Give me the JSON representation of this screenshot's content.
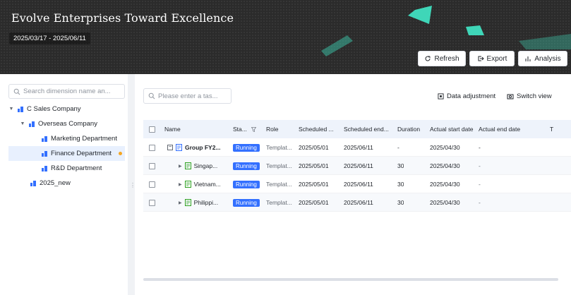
{
  "header": {
    "title": "Evolve Enterprises Toward Excellence",
    "date_range": "2025/03/17 - 2025/06/11",
    "buttons": {
      "refresh": "Refresh",
      "export": "Export",
      "analysis": "Analysis"
    }
  },
  "sidebar": {
    "search_placeholder": "Search dimension name an...",
    "tree": [
      {
        "label": "C Sales Company",
        "level": 0,
        "expanded": true
      },
      {
        "label": "Overseas Company",
        "level": 1,
        "expanded": true
      },
      {
        "label": "Marketing Department",
        "level": 2
      },
      {
        "label": "Finance Department",
        "level": 2,
        "selected": true
      },
      {
        "label": "R&D Department",
        "level": 2
      },
      {
        "label": "2025_new",
        "level": 1
      }
    ]
  },
  "toolbar": {
    "task_search_placeholder": "Please enter a tas...",
    "data_adjustment": "Data adjustment",
    "switch_view": "Switch view"
  },
  "table": {
    "columns": {
      "name": "Name",
      "status": "Sta...",
      "role": "Role",
      "scheduled_start": "Scheduled ...",
      "scheduled_end": "Scheduled end...",
      "duration": "Duration",
      "actual_start": "Actual start date",
      "actual_end": "Actual end date",
      "extra": "T"
    },
    "rows": [
      {
        "name": "Group FY2...",
        "status": "Running",
        "role": "Templat...",
        "scheduled_start": "2025/05/01",
        "scheduled_end": "2025/06/11",
        "duration": "-",
        "actual_start": "2025/04/30",
        "actual_end": "-"
      },
      {
        "name": "Singap...",
        "status": "Running",
        "role": "Templat...",
        "scheduled_start": "2025/05/01",
        "scheduled_end": "2025/06/11",
        "duration": "30",
        "actual_start": "2025/04/30",
        "actual_end": "-"
      },
      {
        "name": "Vietnam...",
        "status": "Running",
        "role": "Templat...",
        "scheduled_start": "2025/05/01",
        "scheduled_end": "2025/06/11",
        "duration": "30",
        "actual_start": "2025/04/30",
        "actual_end": "-"
      },
      {
        "name": "Philippi...",
        "status": "Running",
        "role": "Templat...",
        "scheduled_start": "2025/05/01",
        "scheduled_end": "2025/06/11",
        "duration": "30",
        "actual_start": "2025/04/30",
        "actual_end": "-"
      }
    ]
  },
  "colors": {
    "accent": "#3370ff",
    "header_bg": "#2b2b2b",
    "teal_deco": "#3fd6b8",
    "selected_bg": "#e8f0fe",
    "notify_dot": "#f5a623"
  }
}
